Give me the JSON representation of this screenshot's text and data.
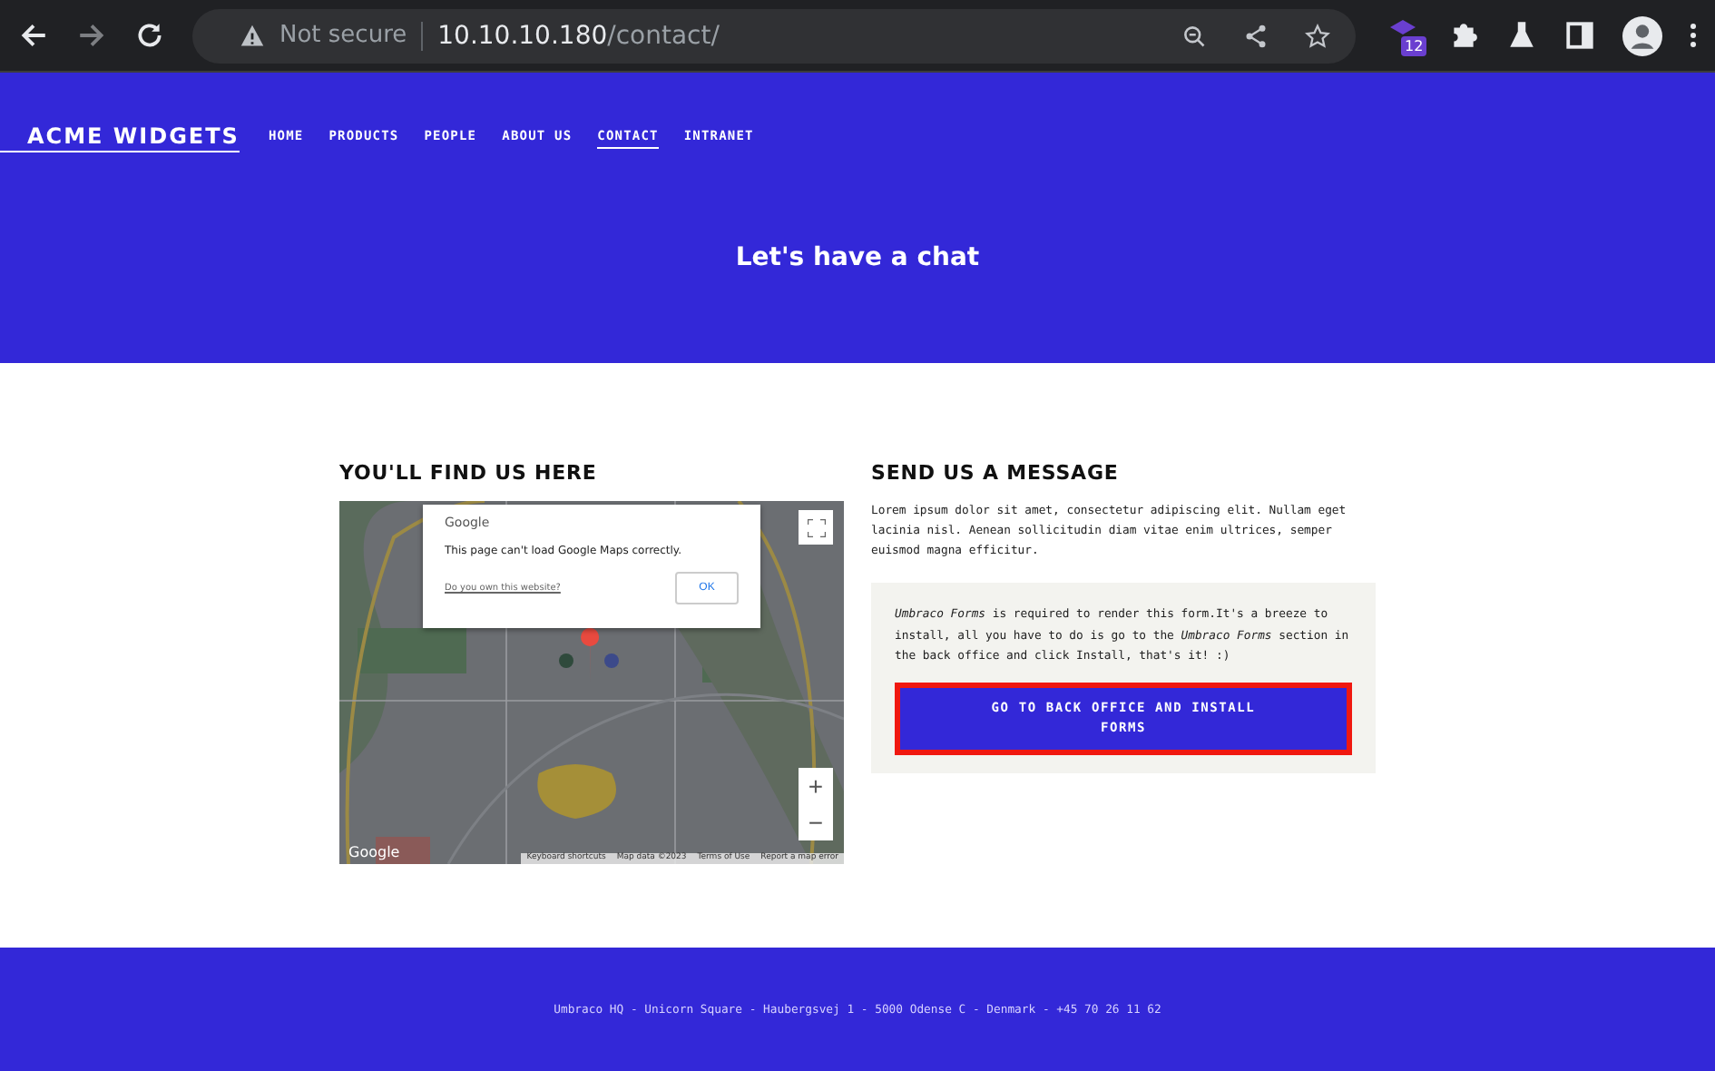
{
  "browser": {
    "security": "Not secure",
    "url_host": "10.10.10.180",
    "url_path": "/contact/",
    "extension_badge": "12"
  },
  "header": {
    "logo": "ACME WIDGETS",
    "nav": [
      {
        "label": "HOME",
        "selected": false
      },
      {
        "label": "PRODUCTS",
        "selected": false
      },
      {
        "label": "PEOPLE",
        "selected": false
      },
      {
        "label": "ABOUT US",
        "selected": false
      },
      {
        "label": "CONTACT",
        "selected": true
      },
      {
        "label": "INTRANET",
        "selected": false
      }
    ],
    "hero_title": "Let's have a chat"
  },
  "find_us": {
    "heading": "YOU'LL FIND US HERE",
    "map": {
      "kind": "picture",
      "dialog": {
        "brand": "Google",
        "message": "This page can't load Google Maps correctly.",
        "link": "Do you own this website?",
        "button": "OK"
      },
      "zoom_in": "+",
      "zoom_out": "−",
      "logo": "Google",
      "attribution": [
        "Keyboard shortcuts",
        "Map data ©2023",
        "Terms of Use",
        "Report a map error"
      ]
    }
  },
  "message": {
    "heading": "SEND US A MESSAGE",
    "intro": "Lorem ipsum dolor sit amet, consectetur adipiscing elit. Nullam eget lacinia nisl. Aenean sollicitudin diam vitae enim ultrices, semper euismod magna efficitur.",
    "notice": "*Umbraco Forms* is required to render this form.It's a breeze to install, all you have to do is go to the *Umbraco Forms* section in the back office and click Install, that's it! :)",
    "button": "GO TO BACK OFFICE AND INSTALL FORMS"
  },
  "footer": "Umbraco HQ - Unicorn Square - Haubergsvej 1 - 5000 Odense C - Denmark - +45 70 26 11 62"
}
